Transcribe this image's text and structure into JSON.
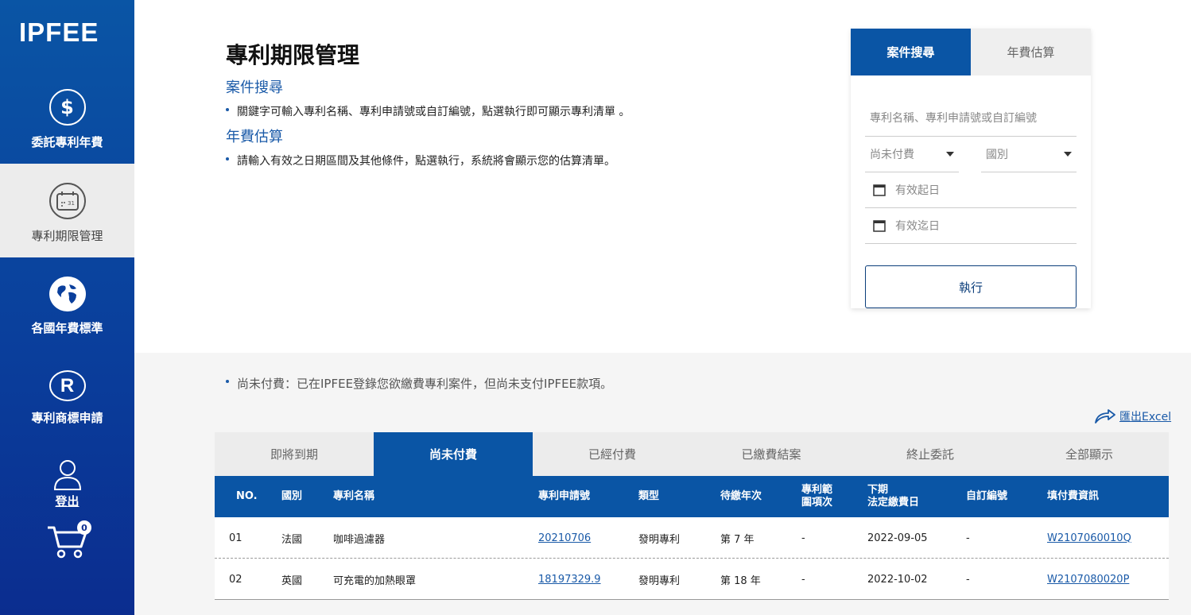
{
  "logo": "IPFEE",
  "sidebar": {
    "items": [
      {
        "label": "委託專利年費"
      },
      {
        "label": "專利期限管理"
      },
      {
        "label": "各國年費標準"
      },
      {
        "label": "專利商標申請"
      }
    ],
    "logout_label": "登出",
    "cart_count": "0"
  },
  "intro": {
    "title": "專利期限管理",
    "search_title": "案件搜尋",
    "search_desc": "關鍵字可輸入專利名稱、專利申請號或自訂編號，點選執行即可顯示專利清單 。",
    "estimate_title": "年費估算",
    "estimate_desc": "請輸入有效之日期區間及其他條件，點選執行，系統將會顯示您的估算清單。"
  },
  "panel": {
    "tab_search": "案件搜尋",
    "tab_estimate": "年費估算",
    "keyword_placeholder": "專利名稱、專利申請號或自訂編號",
    "status_select": "尚未付費",
    "country_select": "國別",
    "start_date_placeholder": "有效起日",
    "end_date_placeholder": "有效迄日",
    "execute_label": "執行"
  },
  "note": "尚未付費：已在IPFEE登錄您欲繳費專利案件，但尚未支付IPFEE款項。",
  "export_label": "匯出Excel",
  "tabs": [
    "即將到期",
    "尚未付費",
    "已經付費",
    "已繳費結案",
    "終止委託",
    "全部顯示"
  ],
  "table": {
    "headers": {
      "no": "NO.",
      "country": "國別",
      "name": "專利名稱",
      "app_no": "專利申請號",
      "type": "類型",
      "year": "待繳年次",
      "scope_line1": "專利範",
      "scope_line2": "圍項次",
      "due_line1": "下期",
      "due_line2": "法定繳費日",
      "custom": "自訂編號",
      "payment": "填付費資訊"
    },
    "rows": [
      {
        "no": "01",
        "country": "法國",
        "name": "咖啡過濾器",
        "app_no": "20210706",
        "type": "發明專利",
        "year": "第 7 年",
        "scope": "-",
        "due": "2022-09-05",
        "custom": "-",
        "payment": "W2107060010Q"
      },
      {
        "no": "02",
        "country": "英國",
        "name": "可充電的加熱眼罩",
        "app_no": "18197329.9",
        "type": "發明專利",
        "year": "第 18 年",
        "scope": "-",
        "due": "2022-10-02",
        "custom": "-",
        "payment": "W2107080020P"
      }
    ]
  }
}
